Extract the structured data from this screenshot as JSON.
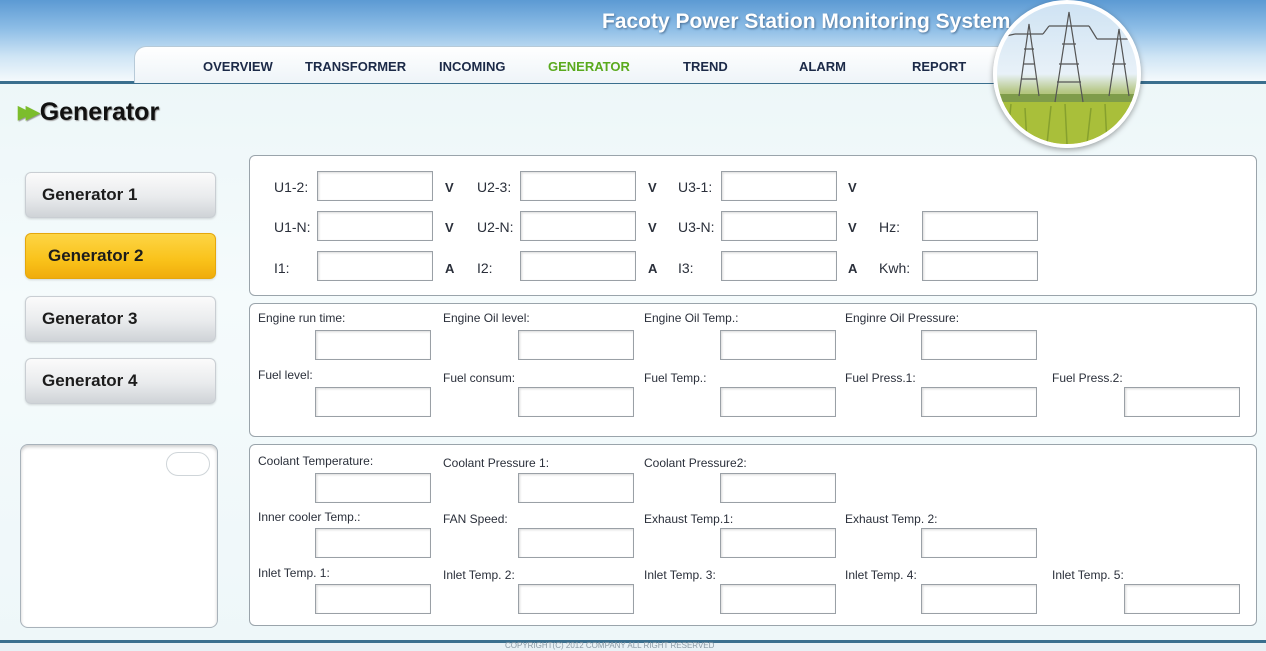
{
  "header": {
    "title": "Facoty Power Station Monitoring System",
    "nav": [
      "OVERVIEW",
      "TRANSFORMER",
      "INCOMING",
      "GENERATOR",
      "TREND",
      "ALARM",
      "REPORT"
    ],
    "active_nav": "GENERATOR",
    "logo_icon": "power-tower-field-image"
  },
  "page": {
    "title": "Generator"
  },
  "generators": [
    "Generator 1",
    "Generator 2",
    "Generator 3",
    "Generator 4"
  ],
  "selected_generator": "Generator 2",
  "colors": {
    "accent_green": "#5aaa1e",
    "active_button": "#f9c21a",
    "header_blue": "#5c9ad3"
  },
  "electrical": {
    "rows": [
      [
        {
          "label": "U1-2:",
          "unit": "V"
        },
        {
          "label": "U2-3:",
          "unit": "V"
        },
        {
          "label": "U3-1:",
          "unit": "V"
        }
      ],
      [
        {
          "label": "U1-N:",
          "unit": "V"
        },
        {
          "label": "U2-N:",
          "unit": "V"
        },
        {
          "label": "U3-N:",
          "unit": "V"
        },
        {
          "label": "Hz:",
          "unit": ""
        }
      ],
      [
        {
          "label": "I1:",
          "unit": "A"
        },
        {
          "label": "I2:",
          "unit": "A"
        },
        {
          "label": "I3:",
          "unit": "A"
        },
        {
          "label": "Kwh:",
          "unit": ""
        }
      ]
    ]
  },
  "engine": {
    "row1": [
      "Engine run time:",
      "Engine Oil level:",
      "Engine Oil Temp.:",
      "Enginre Oil Pressure:"
    ],
    "row2": [
      "Fuel level:",
      "Fuel consum:",
      "Fuel Temp.:",
      "Fuel Press.1:",
      "Fuel Press.2:"
    ]
  },
  "coolant": {
    "row1": [
      "Coolant Temperature:",
      "Coolant Pressure 1:",
      "Coolant Pressure2:"
    ],
    "row2": [
      "Inner cooler Temp.:",
      "FAN Speed:",
      "Exhaust Temp.1:",
      "Exhaust Temp. 2:"
    ],
    "row3": [
      "Inlet Temp. 1:",
      "Inlet Temp. 2:",
      "Inlet Temp. 3:",
      "Inlet Temp. 4:",
      "Inlet Temp. 5:"
    ]
  },
  "footer": {
    "text": "COPYRIGHT(C) 2012 COMPANY ALL RIGHT RESERVED"
  }
}
